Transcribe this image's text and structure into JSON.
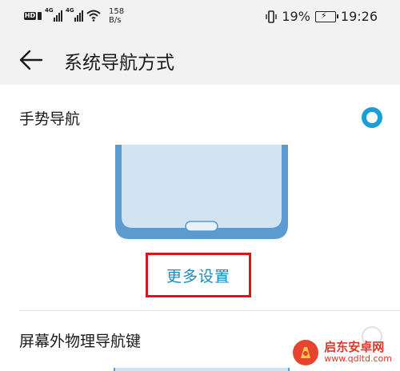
{
  "status_bar": {
    "hd_badge": "HD",
    "network_1": "4G",
    "network_2": "4G",
    "speed_value": "158",
    "speed_unit": "B/s",
    "battery": "19%",
    "time": "19:26"
  },
  "header": {
    "title": "系统导航方式"
  },
  "options": [
    {
      "title": "手势导航",
      "selected": true,
      "more_settings_label": "更多设置"
    },
    {
      "title": "屏幕外物理导航键",
      "selected": false
    }
  ],
  "watermark": {
    "name": "启东安卓网",
    "url": "www.qdltd.com"
  },
  "colors": {
    "accent": "#1aa0d6",
    "highlight_box": "#d8161f",
    "link": "#1a8bbd",
    "phone_screen": "#d2e4f2",
    "phone_body": "#5b9bd0"
  }
}
